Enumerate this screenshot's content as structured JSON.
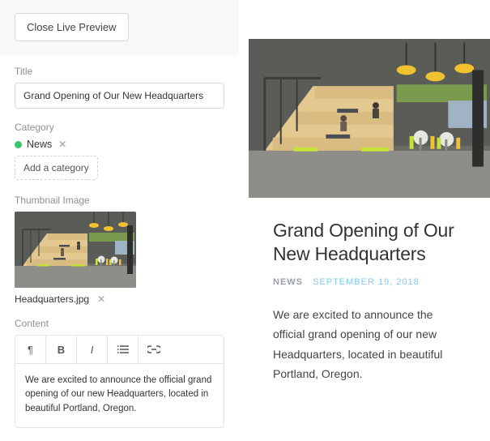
{
  "editor": {
    "close_label": "Close Live Preview",
    "title_label": "Title",
    "title_value": "Grand Opening of Our New Headquarters",
    "category_label": "Category",
    "category_value": "News",
    "add_category_label": "Add a category",
    "thumbnail_label": "Thumbnail Image",
    "thumbnail_filename": "Headquarters.jpg",
    "content_label": "Content",
    "content_value": "We are excited to announce the official grand opening of our new Headquarters, located in beautiful Portland, Oregon."
  },
  "preview": {
    "title": "Grand Opening of Our New Headquarters",
    "category": "NEWS",
    "date": "SEPTEMBER 19, 2018",
    "body": "We are excited to announce the official grand opening of our new Headquarters, located in beautiful Portland, Oregon."
  }
}
